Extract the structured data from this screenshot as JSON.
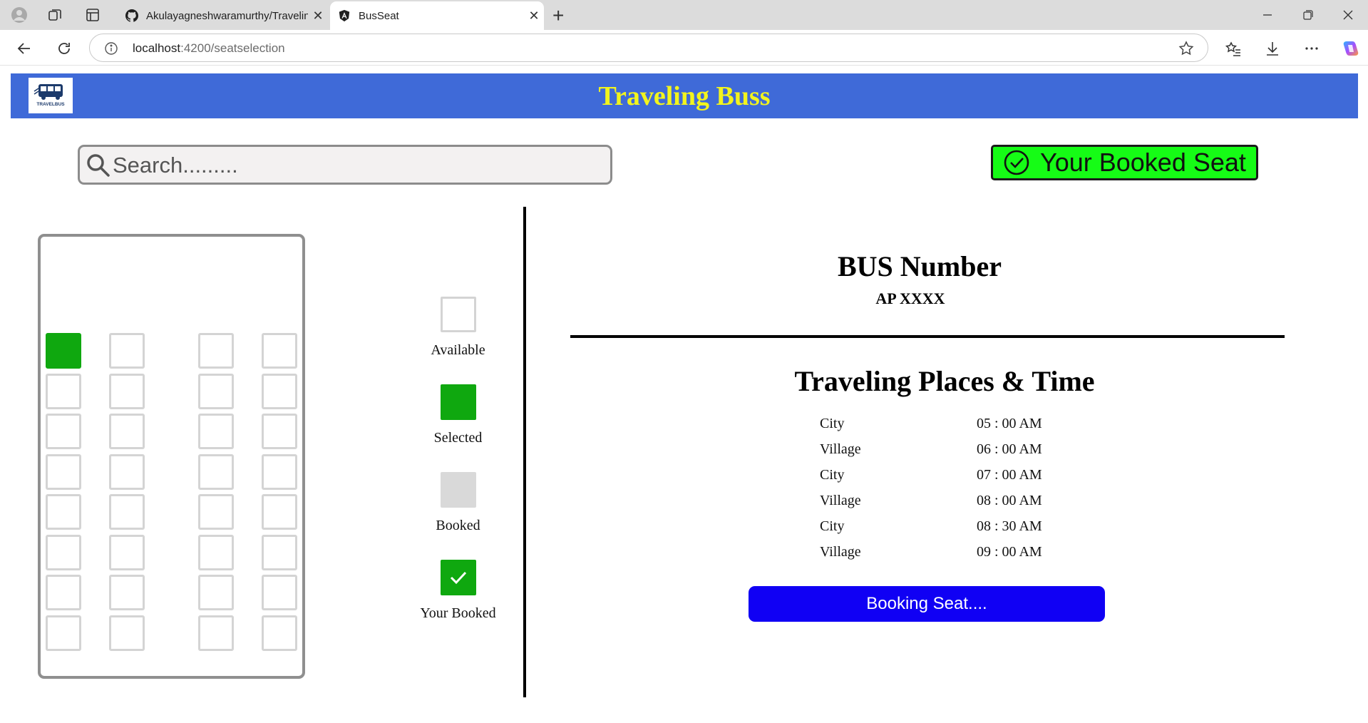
{
  "browser": {
    "tabs": [
      {
        "title": "Akulayagneshwaramurthy/Traveling",
        "active": false,
        "favicon": "github-icon"
      },
      {
        "title": "BusSeat",
        "active": true,
        "favicon": "angular-icon"
      }
    ],
    "url_host": "localhost",
    "url_path": ":4200/seatselection"
  },
  "header": {
    "title": "Traveling Buss",
    "logo_text": "TRAVELBUS",
    "background": "#3f6ad8",
    "title_color": "#f2f41d"
  },
  "search": {
    "placeholder": "Search........."
  },
  "booked_button": {
    "label": "Your Booked Seat",
    "color": "#16fc16"
  },
  "seat_map": {
    "rows": 8,
    "columns": 4,
    "selected_seats": [
      [
        0,
        0
      ]
    ]
  },
  "legend": [
    {
      "key": "available",
      "label": "Available"
    },
    {
      "key": "selected",
      "label": "Selected",
      "color": "#0fa80f"
    },
    {
      "key": "booked",
      "label": "Booked",
      "color": "#d9d9d9"
    },
    {
      "key": "yours",
      "label": "Your Booked",
      "color": "#0fa80f"
    }
  ],
  "bus": {
    "heading": "BUS Number",
    "number": "AP XXXX"
  },
  "schedule": {
    "title": "Traveling Places & Time",
    "stops": [
      {
        "place": "City",
        "time": "05 : 00 AM"
      },
      {
        "place": "Village",
        "time": "06 : 00 AM"
      },
      {
        "place": "City",
        "time": "07 : 00 AM"
      },
      {
        "place": "Village",
        "time": "08 : 00 AM"
      },
      {
        "place": "City",
        "time": "08 : 30 AM"
      },
      {
        "place": "Village",
        "time": "09 : 00 AM"
      }
    ]
  },
  "booking_button": {
    "label": "Booking Seat....",
    "color": "#1000f4"
  }
}
